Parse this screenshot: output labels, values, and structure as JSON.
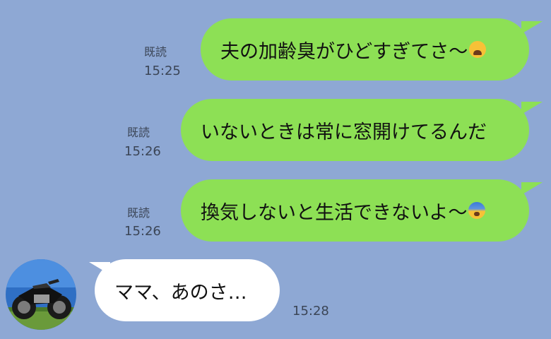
{
  "colors": {
    "background": "#8ea8d4",
    "outgoing_bubble": "#8de055",
    "incoming_bubble": "#ffffff"
  },
  "messages": [
    {
      "direction": "outgoing",
      "text": "夫の加齢臭がひどすぎてさ〜",
      "emoji": "weary-face-emoji",
      "read": "既読",
      "time": "15:25"
    },
    {
      "direction": "outgoing",
      "text": "いないときは常に窓開けてるんだ",
      "read": "既読",
      "time": "15:26"
    },
    {
      "direction": "outgoing",
      "text": "換気しないと生活できないよ〜",
      "emoji": "anxious-face-with-sweat-emoji",
      "read": "既読",
      "time": "15:26"
    },
    {
      "direction": "incoming",
      "text": "ママ、あのさ…",
      "time": "15:28",
      "avatar": "motorcycle-avatar"
    }
  ]
}
